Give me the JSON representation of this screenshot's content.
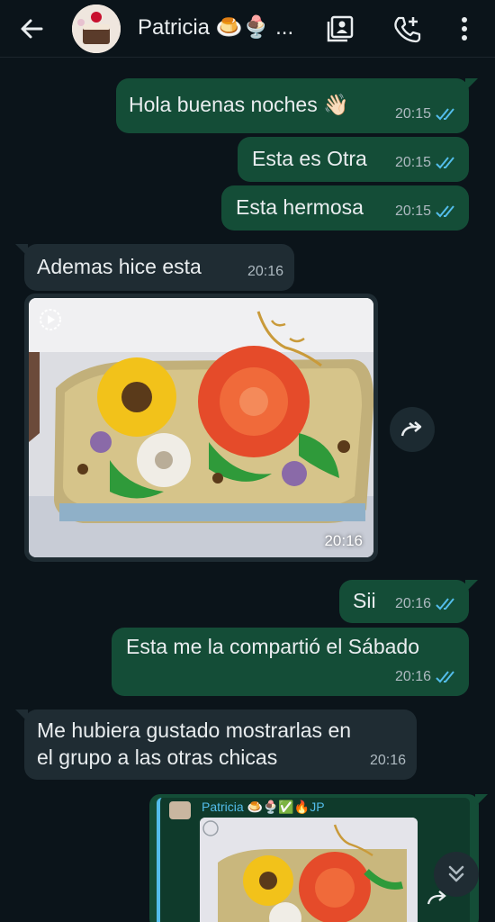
{
  "header": {
    "contact_name": "Patricia 🍮🍨 ...",
    "icons": [
      "back-arrow-icon",
      "avatar",
      "contact-card-icon",
      "add-call-icon",
      "more-vert-icon"
    ]
  },
  "messages": [
    {
      "dir": "out",
      "text": "Hola buenas noches 👋🏻",
      "time": "20:15",
      "status": "read"
    },
    {
      "dir": "out",
      "text": "Esta es Otra",
      "time": "20:15",
      "status": "read"
    },
    {
      "dir": "out",
      "text": "Esta hermosa",
      "time": "20:15",
      "status": "read"
    },
    {
      "dir": "in",
      "text": "Ademas hice esta",
      "time": "20:16"
    },
    {
      "dir": "in",
      "type": "image",
      "time": "20:16"
    },
    {
      "dir": "out",
      "text": "Sii",
      "time": "20:16",
      "status": "read"
    },
    {
      "dir": "out",
      "text": "Esta me la compartió el Sábado",
      "time": "20:16",
      "status": "read"
    },
    {
      "dir": "in",
      "text_line1": "Me hubiera gustado mostrarlas en",
      "text_line2": "el grupo a las otras chicas",
      "time": "20:16"
    }
  ],
  "forwarded": {
    "author": "Patricia 🍮🍨✅🔥JP"
  },
  "colors": {
    "background": "#0b141a",
    "outgoing_bubble": "#144d37",
    "incoming_bubble": "#1f2c33",
    "read_ticks": "#53bdeb",
    "meta_text": "#aebac1"
  }
}
